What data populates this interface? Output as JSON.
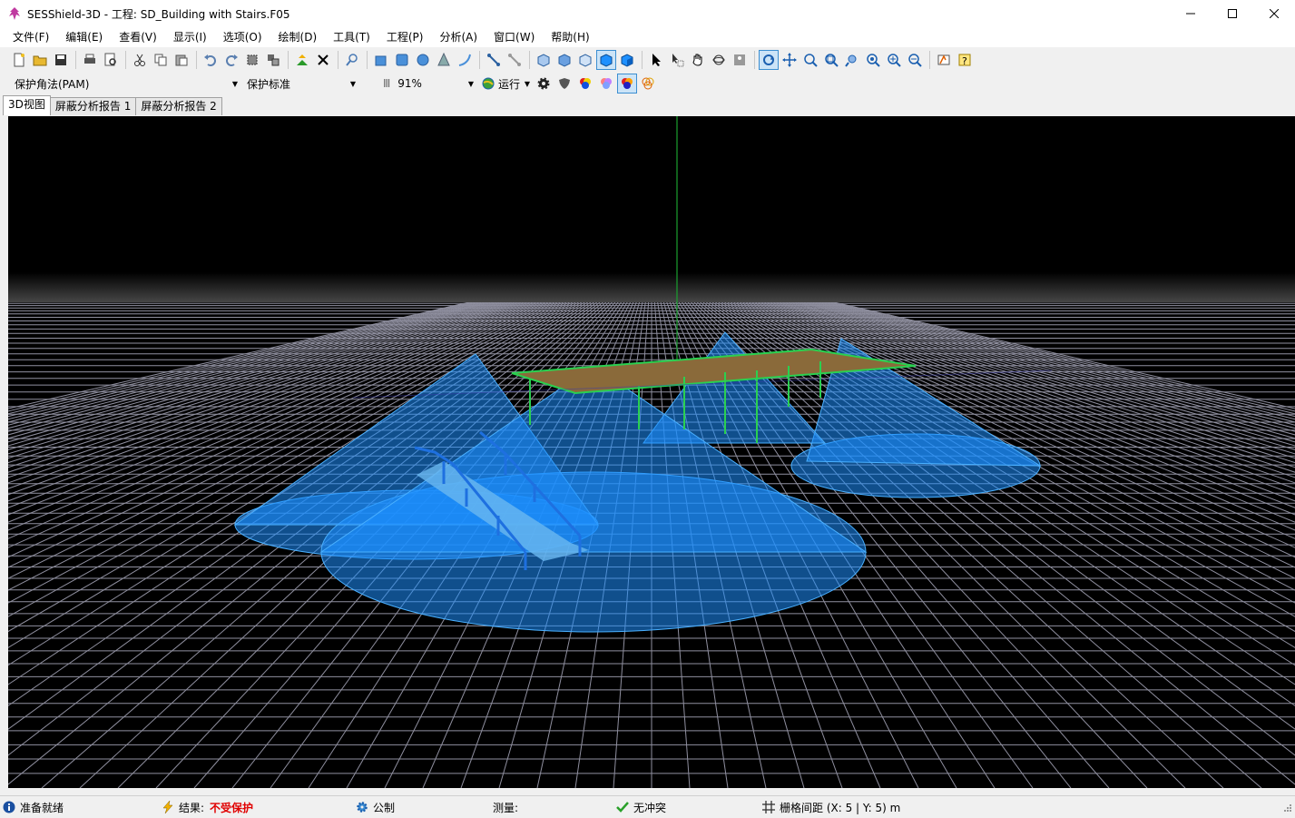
{
  "window": {
    "title": "SESShield-3D - 工程: SD_Building with Stairs.F05"
  },
  "menu": {
    "items": [
      "文件(F)",
      "编辑(E)",
      "查看(V)",
      "显示(I)",
      "选项(O)",
      "绘制(D)",
      "工具(T)",
      "工程(P)",
      "分析(A)",
      "窗口(W)",
      "帮助(H)"
    ]
  },
  "toolbar2": {
    "method": "保护角法(PAM)",
    "standard": "保护标准",
    "zoom": "91%",
    "run_label": "运行"
  },
  "tabs": [
    "3D视图",
    "屏蔽分析报告 1",
    "屏蔽分析报告 2"
  ],
  "status": {
    "ready": "准备就绪",
    "result_label": "结果:",
    "result_value": "不受保护",
    "units": "公制",
    "measure": "测量:",
    "conflict": "无冲突",
    "grid": "栅格间距 (X: 5 | Y: 5) m"
  },
  "colors": {
    "accent": "#3c8fd1",
    "zone_fill": "#1e90ff",
    "result_red": "#e00000"
  }
}
